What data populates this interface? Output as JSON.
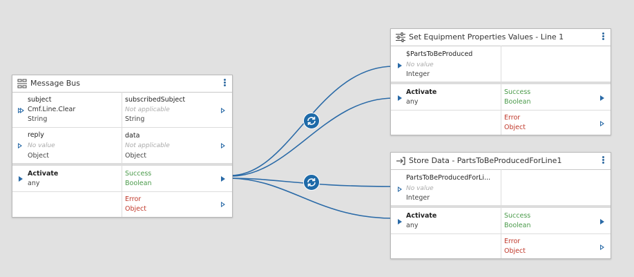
{
  "nodes": {
    "message_bus": {
      "title": "Message Bus",
      "icon": "message-bus-icon",
      "inputs": [
        {
          "name": "subject",
          "value": "Cmf.Line.Clear",
          "type": "String"
        },
        {
          "name": "reply",
          "value": "No value",
          "type": "Object"
        }
      ],
      "outputs_top": [
        {
          "name": "subscribedSubject",
          "value": "Not applicable",
          "type": "String"
        },
        {
          "name": "data",
          "value": "Not applicable",
          "type": "Object"
        }
      ],
      "activate": {
        "name": "Activate",
        "type": "any"
      },
      "success": {
        "name": "Success",
        "type": "Boolean"
      },
      "error": {
        "name": "Error",
        "type": "Object"
      }
    },
    "set_equipment": {
      "title": "Set Equipment Properties Values - Line 1",
      "icon": "sliders-icon",
      "inputs": [
        {
          "name": "$PartsToBeProduced",
          "value": "No value",
          "type": "Integer"
        }
      ],
      "activate": {
        "name": "Activate",
        "type": "any"
      },
      "success": {
        "name": "Success",
        "type": "Boolean"
      },
      "error": {
        "name": "Error",
        "type": "Object"
      }
    },
    "store_data": {
      "title": "Store Data - PartsToBeProducedForLine1",
      "icon": "store-arrow-icon",
      "inputs": [
        {
          "name": "PartsToBeProducedForLi...",
          "value": "No value",
          "type": "Integer"
        }
      ],
      "activate": {
        "name": "Activate",
        "type": "any"
      },
      "success": {
        "name": "Success",
        "type": "Boolean"
      },
      "error": {
        "name": "Error",
        "type": "Object"
      }
    }
  },
  "converters": [
    {
      "icon": "convert-icon"
    },
    {
      "icon": "convert-icon"
    }
  ],
  "colors": {
    "wire": "#2a6aa7",
    "success": "#4a9a4a",
    "error": "#c0392b",
    "canvas": "#e1e1e1"
  }
}
